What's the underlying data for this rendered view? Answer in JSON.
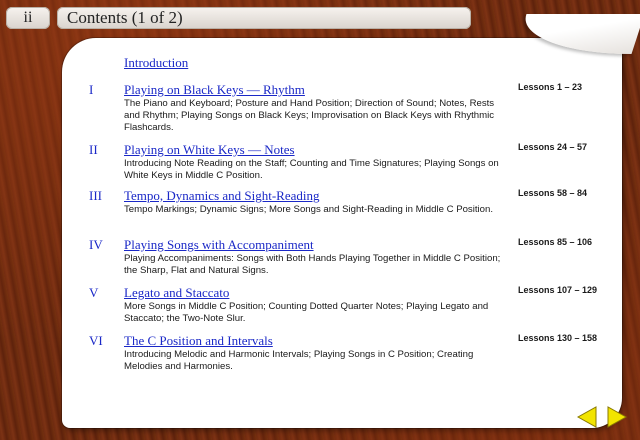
{
  "header": {
    "page_label": "ii",
    "title": "Contents (1 of 2)"
  },
  "intro": {
    "label": "Introduction"
  },
  "entries": [
    {
      "numeral": "I",
      "title": "Playing on Black Keys — Rhythm",
      "description": "The Piano and Keyboard; Posture and Hand Position; Direction of Sound; Notes, Rests and Rhythm; Playing Songs on Black Keys; Improvisation on Black Keys with Rhythmic Flashcards.",
      "lessons": "Lessons 1 – 23"
    },
    {
      "numeral": "II",
      "title": "Playing on White Keys — Notes",
      "description": "Introducing Note Reading on the Staff; Counting and Time Signatures; Playing Songs on White Keys in Middle C Position.",
      "lessons": "Lessons 24 – 57"
    },
    {
      "numeral": "III",
      "title": "Tempo, Dynamics and Sight-Reading",
      "description": "Tempo Markings; Dynamic Signs; More Songs and Sight-Reading in Middle C Position.",
      "lessons": "Lessons 58 – 84"
    },
    {
      "numeral": "IV",
      "title": "Playing Songs with Accompaniment",
      "description": "Playing Accompaniments: Songs with Both Hands Playing Together in Middle C Position; the Sharp, Flat and Natural Signs.",
      "lessons": "Lessons 85 – 106"
    },
    {
      "numeral": "V",
      "title": "Legato and Staccato",
      "description": "More Songs in Middle C Position; Counting Dotted Quarter Notes; Playing Legato and Staccato; the Two-Note Slur.",
      "lessons": "Lessons 107 – 129"
    },
    {
      "numeral": "VI",
      "title": "The C Position and Intervals",
      "description": "Introducing Melodic and Harmonic Intervals; Playing Songs in C Position; Creating Melodies and Harmonies.",
      "lessons": "Lessons 130 – 158"
    }
  ],
  "nav": {
    "prev_icon": "arrow-left-icon",
    "next_icon": "arrow-right-icon",
    "arrow_color": "#f2e400"
  },
  "colors": {
    "link": "#1a28c7",
    "background_wood": "#6a2810"
  }
}
